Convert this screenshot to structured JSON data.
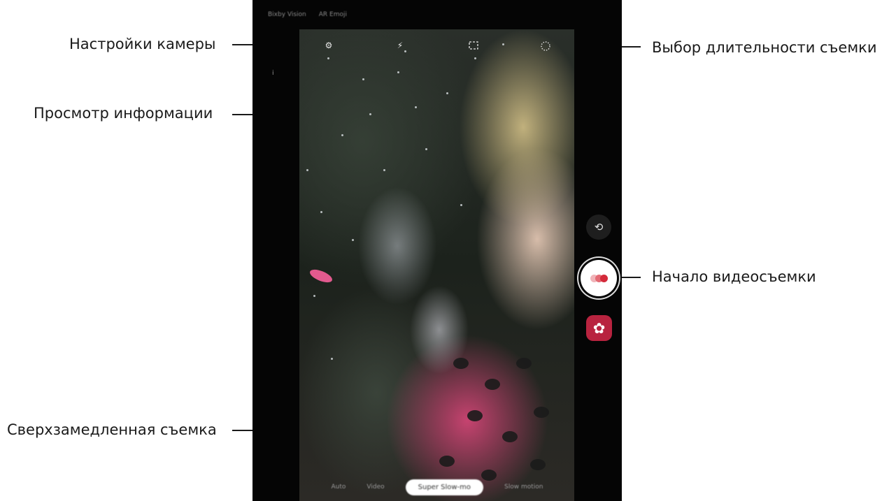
{
  "callouts": {
    "camera_settings": "Настройки камеры",
    "view_info": "Просмотр информации",
    "duration_select": "Выбор длительности съемки",
    "start_recording": "Начало видеосъемки",
    "super_slow_mo": "Сверхзамедленная съемка"
  },
  "camera": {
    "top_tabs": [
      "Bixby Vision",
      "AR Emoji"
    ],
    "info_marker": "i",
    "modes": [
      "Auto",
      "Video",
      "Super Slow-mo",
      "Slow motion"
    ],
    "active_mode_index": 2,
    "icons": {
      "settings": "gear-icon",
      "flash": "flash-off-icon",
      "ratio": "aspect-ratio-icon",
      "duration": "duration-dial-icon",
      "switch": "switch-camera-icon",
      "record": "record-icon",
      "gallery": "gallery-icon"
    },
    "colors": {
      "record_dots": [
        "#f0b3b8",
        "#e36a74",
        "#d42a3a"
      ],
      "gallery_bg": "#b8233f"
    }
  }
}
